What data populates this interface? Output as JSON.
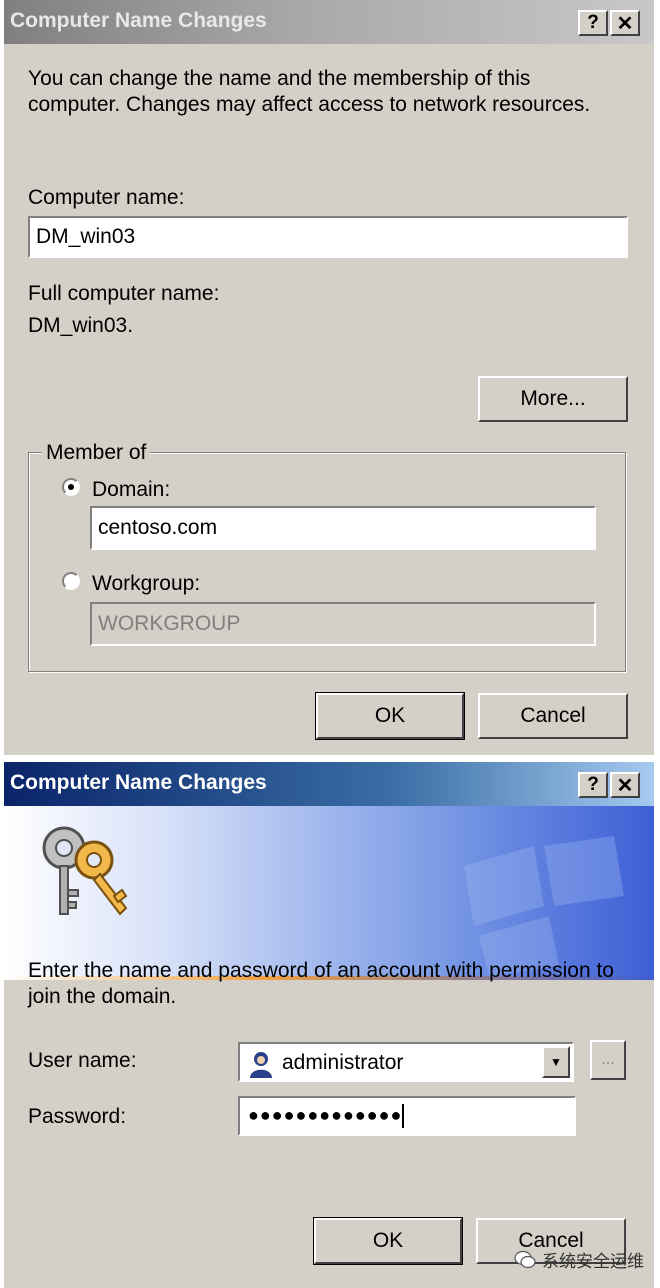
{
  "dialog1": {
    "title": "Computer Name Changes",
    "help_label": "?",
    "close_label": "✕",
    "description": "You can change the name and the membership of this computer. Changes may affect access to network resources.",
    "computer_name_label": "Computer name:",
    "computer_name_value": "DM_win03",
    "full_name_label": "Full computer name:",
    "full_name_value": "DM_win03.",
    "more_button": "More...",
    "member_of_label": "Member of",
    "domain_label": "Domain:",
    "domain_value": "centoso.com",
    "domain_selected": true,
    "workgroup_label": "Workgroup:",
    "workgroup_value": "WORKGROUP",
    "ok_button": "OK",
    "cancel_button": "Cancel"
  },
  "dialog2": {
    "title": "Computer Name Changes",
    "help_label": "?",
    "close_label": "✕",
    "description": "Enter the name and password of an account with permission to join the domain.",
    "user_name_label": "User name:",
    "user_name_value": "administrator",
    "browse_label": "...",
    "password_label": "Password:",
    "password_value": "●●●●●●●●●●●●●",
    "ok_button": "OK",
    "cancel_button": "Cancel"
  },
  "watermark": {
    "text": "系统安全运维"
  },
  "icons": [
    "keys-icon",
    "user-icon",
    "chevron-down-icon",
    "help-icon",
    "close-icon",
    "windows-logo-watermark-icon",
    "wechat-icon"
  ]
}
